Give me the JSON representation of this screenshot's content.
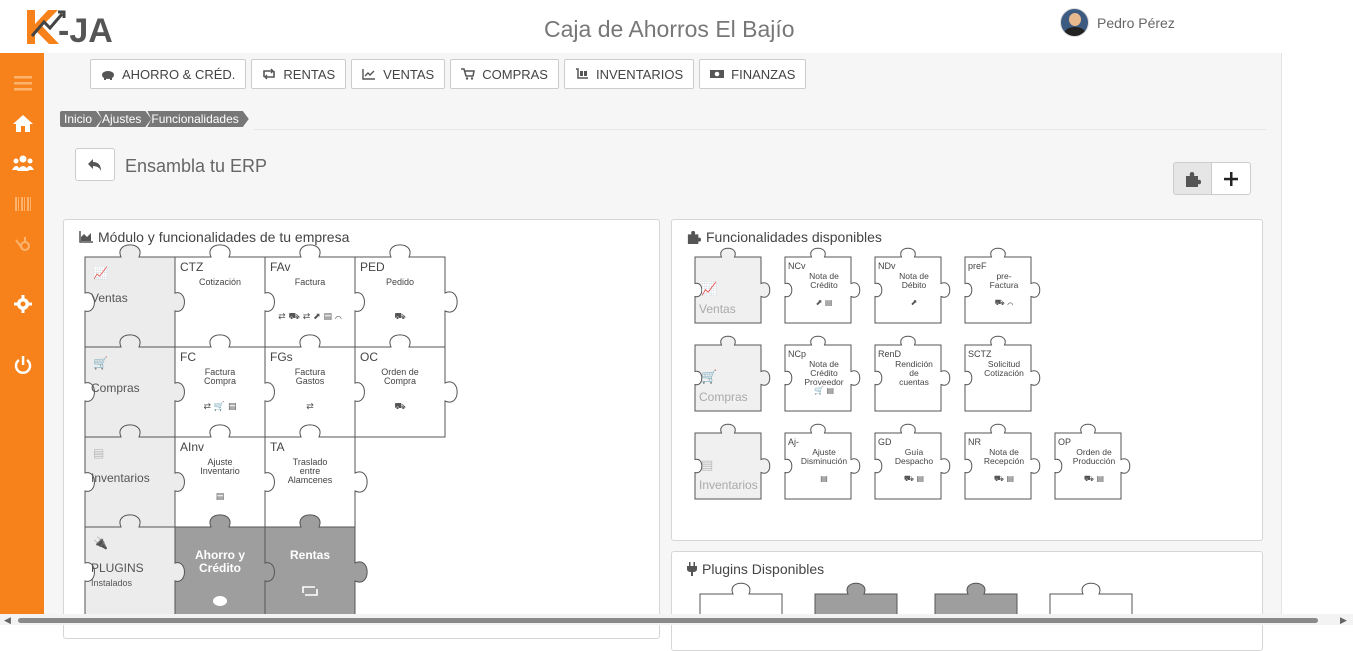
{
  "header": {
    "app_title": "Caja de Ahorros El Bajío",
    "user_name": "Pedro Pérez",
    "brand": "#f7821b"
  },
  "sidebar": {
    "items": [
      {
        "name": "menu-icon"
      },
      {
        "name": "home-icon"
      },
      {
        "name": "users-icon"
      },
      {
        "name": "barcode-icon"
      },
      {
        "name": "hubspot-icon"
      },
      {
        "name": "gear-icon"
      },
      {
        "name": "power-icon"
      }
    ]
  },
  "tabs": [
    {
      "label": "AHORRO & CRÉD.",
      "icon": "piggy-bank-icon"
    },
    {
      "label": "RENTAS",
      "icon": "retweet-icon"
    },
    {
      "label": "VENTAS",
      "icon": "line-chart-icon"
    },
    {
      "label": "COMPRAS",
      "icon": "cart-icon"
    },
    {
      "label": "INVENTARIOS",
      "icon": "dolly-icon"
    },
    {
      "label": "FINANZAS",
      "icon": "money-icon"
    }
  ],
  "breadcrumbs": [
    "Inicio",
    "Ajustes",
    "Funcionalidades"
  ],
  "page": {
    "title": "Ensambla tu ERP"
  },
  "panels": {
    "company": {
      "title": "Módulo y funcionalidades de tu empresa"
    },
    "available": {
      "title": "Funcionalidades disponibles"
    },
    "plugins": {
      "title": "Plugins Disponibles"
    }
  },
  "company_rows": [
    {
      "module": "Ventas",
      "icon": "line-chart-icon",
      "pieces": [
        {
          "code": "CTZ",
          "name": "Cotización",
          "icons": ""
        },
        {
          "code": "FAv",
          "name": "Factura",
          "icons": "⇄ ⛟ ⇄ ⬈ ▤ ⌒"
        },
        {
          "code": "PED",
          "name": "Pedido",
          "icons": "⛟"
        }
      ]
    },
    {
      "module": "Compras",
      "icon": "cart-icon",
      "pieces": [
        {
          "code": "FC",
          "name": "Factura\nCompra",
          "icons": "⇄ 🛒 ▤"
        },
        {
          "code": "FGs",
          "name": "Factura\nGastos",
          "icons": "⇄"
        },
        {
          "code": "OC",
          "name": "Orden de\nCompra",
          "icons": "⛟"
        }
      ]
    },
    {
      "module": "Inventarios",
      "icon": "dolly-icon",
      "pieces": [
        {
          "code": "AInv",
          "name": "Ajuste\nInventario",
          "icons": "▤"
        },
        {
          "code": "TA",
          "name": "Traslado\nentre\nAlamcenes",
          "icons": ""
        }
      ]
    },
    {
      "module": "PLUGINS",
      "sub": "Instalados",
      "icon": "plug-icon",
      "pieces": [
        {
          "code": "",
          "name": "Ahorro y\nCrédito",
          "icons": "piggy",
          "dark": true
        },
        {
          "code": "",
          "name": "Rentas",
          "icons": "retweet",
          "dark": true
        }
      ]
    }
  ],
  "available_rows": [
    {
      "module": "Ventas",
      "icon": "line-chart-icon",
      "pieces": [
        {
          "code": "NCv",
          "name": "Nota de\nCrédito",
          "icons": "⬈ ▤"
        },
        {
          "code": "NDv",
          "name": "Nota de\nDébito",
          "icons": "⬈"
        },
        {
          "code": "preF",
          "name": "pre-\nFactura",
          "icons": "⛟ ⌒"
        }
      ]
    },
    {
      "module": "Compras",
      "icon": "cart-icon",
      "pieces": [
        {
          "code": "NCp",
          "name": "Nota de\nCrédito\nProveedor",
          "icons": "🛒 ▤"
        },
        {
          "code": "RenD",
          "name": "Rendición\nde\ncuentas",
          "icons": ""
        },
        {
          "code": "SCTZ",
          "name": "Solicitud\nCotización",
          "icons": ""
        }
      ]
    },
    {
      "module": "Inventarios",
      "icon": "dolly-icon",
      "pieces": [
        {
          "code": "Aj-",
          "name": "Ajuste\nDisminución",
          "icons": "▤"
        },
        {
          "code": "GD",
          "name": "Guía\nDespacho",
          "icons": "⛟ ▤"
        },
        {
          "code": "NR",
          "name": "Nota de\nRecepción",
          "icons": "⛟ ▤"
        },
        {
          "code": "OP",
          "name": "Orden de\nProducción",
          "icons": "⛟ ▤"
        }
      ]
    }
  ]
}
